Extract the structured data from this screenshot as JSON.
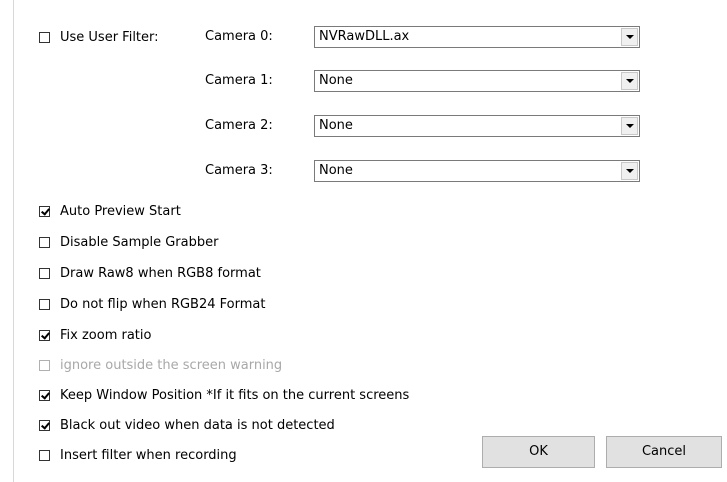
{
  "user_filter": {
    "label": "Use User Filter:",
    "checked": false
  },
  "cameras": [
    {
      "label": "Camera 0:",
      "value": "NVRawDLL.ax"
    },
    {
      "label": "Camera 1:",
      "value": "None"
    },
    {
      "label": "Camera 2:",
      "value": "None"
    },
    {
      "label": "Camera 3:",
      "value": "None"
    }
  ],
  "options": [
    {
      "label": "Auto Preview Start",
      "checked": true,
      "enabled": true
    },
    {
      "label": "Disable Sample Grabber",
      "checked": false,
      "enabled": true
    },
    {
      "label": "Draw Raw8 when RGB8 format",
      "checked": false,
      "enabled": true
    },
    {
      "label": "Do not flip when RGB24 Format",
      "checked": false,
      "enabled": true
    },
    {
      "label": "Fix zoom ratio",
      "checked": true,
      "enabled": true
    },
    {
      "label": "ignore outside the screen warning",
      "checked": false,
      "enabled": false
    },
    {
      "label": "Keep Window Position *If it fits on the current screens",
      "checked": true,
      "enabled": true
    },
    {
      "label": "Black out video when data is not detected",
      "checked": true,
      "enabled": true
    },
    {
      "label": "Insert filter when recording",
      "checked": false,
      "enabled": true
    }
  ],
  "buttons": {
    "ok": "OK",
    "cancel": "Cancel"
  }
}
